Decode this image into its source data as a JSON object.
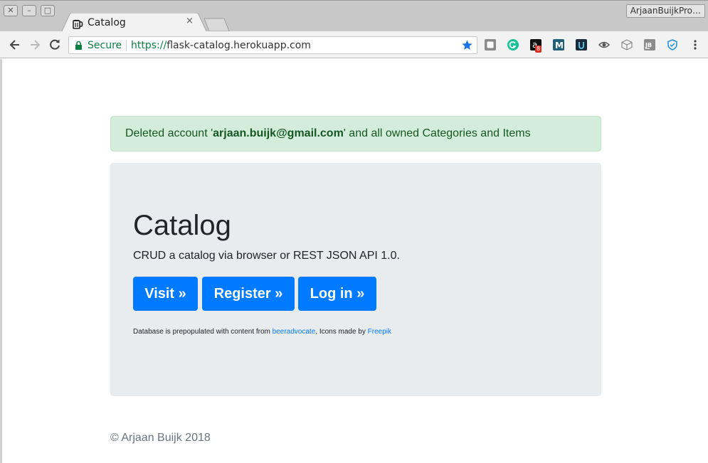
{
  "window": {
    "profile_name": "ArjaanBuijkPro…"
  },
  "tab": {
    "title": "Catalog",
    "close_glyph": "×"
  },
  "address_bar": {
    "secure_label": "Secure",
    "url_scheme": "https://",
    "url_rest": "flask-catalog.herokuapp.com"
  },
  "extensions": [
    {
      "name": "pocket-icon"
    },
    {
      "name": "grammarly-icon"
    },
    {
      "name": "amazon-assistant-icon",
      "badge": "8"
    },
    {
      "name": "m-extension-icon"
    },
    {
      "name": "u-extension-icon"
    },
    {
      "name": "eye-icon"
    },
    {
      "name": "cube-icon"
    },
    {
      "name": "jetbrains-icon"
    },
    {
      "name": "shield-icon"
    }
  ],
  "alert": {
    "prefix": "Deleted account '",
    "email": "arjaan.buijk@gmail.com",
    "suffix": "' and all owned Categories and Items"
  },
  "jumbotron": {
    "title": "Catalog",
    "lead": "CRUD a catalog via browser or REST JSON API 1.0.",
    "buttons": {
      "visit": "Visit »",
      "register": "Register »",
      "login": "Log in »"
    },
    "credits": {
      "text1": "Database is prepopulated with content from ",
      "link1": "beeradvocate",
      "text2": ", Icons made by ",
      "link2": "Freepik"
    }
  },
  "footer": {
    "copyright": "© Arjaan Buijk 2018"
  },
  "colors": {
    "primary": "#007bff",
    "alert_bg": "#d4edda",
    "alert_text": "#155724",
    "jumbotron_bg": "#e9ecef",
    "secure_green": "#0b8043"
  }
}
